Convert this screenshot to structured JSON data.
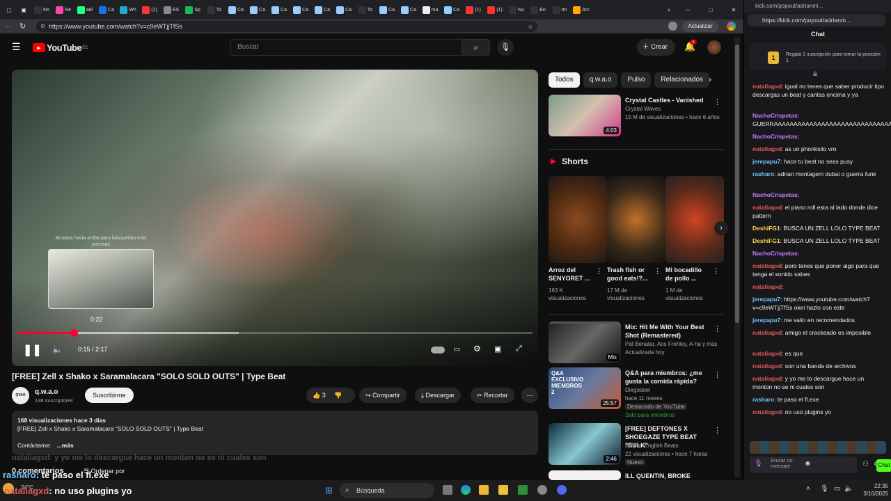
{
  "browser": {
    "url": "https://www.youtube.com/watch?v=c9eWTjjTfSs",
    "update_label": "Actualizar",
    "tabs": [
      "No",
      "Re",
      "adi",
      "Ca",
      "Wh",
      "(1)",
      "ES",
      "Sp",
      "To",
      "Ca",
      "Ca",
      "Ca",
      "Ca",
      "Ca",
      "Ca",
      "To",
      "Ca",
      "Ca",
      "ma",
      "Ca",
      "(1)",
      "(1)",
      "Nu",
      "En",
      "tm",
      "Arc"
    ],
    "window": {
      "min": "—",
      "max": "□",
      "close": "✕"
    }
  },
  "youtube": {
    "logo": "YouTube",
    "region": "EC",
    "search_placeholder": "Buscar",
    "create_label": "Crear",
    "notif_count": "1",
    "video": {
      "title": "[FREE] Zell x Shako x Saramalacara \"SOLO SOLD OUTS\" | Type Beat",
      "time": "0:15 / 2:17",
      "hover_time": "0:22",
      "hint": "Arrastra hacia arriba para búsquedas más precisas",
      "progress": 0.11,
      "buffered": 0.43,
      "hover": 0.163
    },
    "channel": {
      "name": "q.w.a.o",
      "subs": "138 suscriptores",
      "avatar": "QVAO"
    },
    "subscribe_label": "Suscribirme",
    "likes": "3",
    "actions": {
      "share": "Compartir",
      "download": "Descargar",
      "clip": "Recortar"
    },
    "description": {
      "stats": "168 visualizaciones  hace 3 días",
      "line1": "[FREE] Zell x Shako x Saramalacara \"SOLO SOLD OUTS\" | Type Beat",
      "line2": "Contáctame:",
      "more": "...más"
    },
    "comments_label": "0 comentarios",
    "sort_label": "Ordenar por",
    "chips": [
      "Todos",
      "q.w.a.o",
      "Pulso",
      "Relacionados"
    ],
    "related": [
      {
        "title": "Crystal Castles - Vanished",
        "channel": "Crystal Waves",
        "meta": "15 M de visualizaciones • hace 6 años",
        "dur": "4:03"
      },
      {
        "title": "Mix: Hit Me With Your Best Shot (Remastered)",
        "channel": "Pat Benatar, Ace Frehley, A-ha y más",
        "meta": "Actualizada hoy",
        "dur": "Mix"
      },
      {
        "title": "Q&A para miembros: ¿me gusta la comida rápida?",
        "channel": "Diegodoel",
        "meta": "hace 11 meses",
        "badge": "Destacado de YouTube",
        "badge2": "Solo para miembros",
        "dur": "25:57",
        "thumb_text": "Q&A EXCLUSIVO MIEMBROS 2"
      },
      {
        "title": "[FREE] DEFTONES X SHOEGAZE TYPE BEAT \"SULK\"",
        "channel": "Broken English Beats",
        "meta": "22 visualizaciones • hace 7 horas",
        "badge": "Nuevo",
        "dur": "2:46"
      },
      {
        "title": "ILL QUENTIN, BROKE CARREY -",
        "channel": "",
        "meta": "",
        "dur": ""
      }
    ],
    "shorts_title": "Shorts",
    "shorts": [
      {
        "title": "Arroz del SENYORET ...",
        "views": "163 K visualizaciones"
      },
      {
        "title": "Trash fish or good eats!?...",
        "views": "17 M de visualizaciones"
      },
      {
        "title": "Mi bocadillo de pollo ...",
        "views": "1 M de visualizaciones"
      }
    ]
  },
  "overlay": {
    "line1": "nataliagxd: y yo me lo descargue hace un monton no se ni cuales son",
    "line2_user": "rasharo",
    "line2_text": ": te paso el fl.exe",
    "line3_user": "nataliagxd",
    "line3_text": ": no uso plugins yo"
  },
  "kick": {
    "url": "https://kick.com/popout/adrianm...",
    "tab_url": "kick.com/popout/adrianmi...",
    "chat_title": "Chat",
    "pinned": "Regala 1 suscripción para tomar la posición 1",
    "pinned_rank": "1",
    "send_placeholder": "Enviar un mensaje",
    "chat_label": "Chat",
    "messages": [
      {
        "user": "nataliagxd",
        "color": "#e05a5a",
        "text": ": igual no tenes que saber producir tipo descargas un beat y cantas encima y ya"
      },
      {
        "user": "NachoCrispetas",
        "color": "#c77dff",
        "text": ": GUERRAAAAAAAAAAAAAAAAAAAAAAAAAAAAAAAAA"
      },
      {
        "user": "NachoCrispetas",
        "color": "#c77dff",
        "text": ":"
      },
      {
        "user": "nataliagxd",
        "color": "#e05a5a",
        "text": ": as un phonksito vro"
      },
      {
        "user": "jerepapu7",
        "color": "#6ec6ff",
        "text": ": hace tu beat no seas pusy"
      },
      {
        "user": "rasharo",
        "color": "#6ec6ff",
        "text": ": adrian montagem dubai o guerra funk"
      },
      {
        "user": "NachoCrispetas",
        "color": "#c77dff",
        "text": ":"
      },
      {
        "user": "nataliagxd",
        "color": "#e05a5a",
        "text": ": el piano roll esta al lado donde dice pattern"
      },
      {
        "user": "DeshiFG1",
        "color": "#ffd54f",
        "text": ": BUSCA UN ZELL LOLO TYPE BEAT"
      },
      {
        "user": "DeshiFG1",
        "color": "#ffd54f",
        "text": ": BUSCA UN ZELL LOLO TYPE BEAT"
      },
      {
        "user": "NachoCrispetas",
        "color": "#c77dff",
        "text": ":"
      },
      {
        "user": "nataliagxd",
        "color": "#e05a5a",
        "text": ": pero tenes que poner algo para que tenga el sonido sabes"
      },
      {
        "user": "nataliagxd",
        "color": "#e05a5a",
        "text": ":"
      },
      {
        "user": "jerepapu7",
        "color": "#6ec6ff",
        "text": ": https://www.youtube.com/watch?v=c9eWTjjTfSs okei hazlo con este"
      },
      {
        "user": "jerepapu7",
        "color": "#6ec6ff",
        "text": ": me salio en recomendados"
      },
      {
        "user": "nataliagxd",
        "color": "#e05a5a",
        "text": ": amigo el crackeado es imposible"
      },
      {
        "user": "nataliagxd",
        "color": "#e05a5a",
        "text": ": es que"
      },
      {
        "user": "nataliagxd",
        "color": "#e05a5a",
        "text": ": son una banda de archivos"
      },
      {
        "user": "nataliagxd",
        "color": "#e05a5a",
        "text": ": y yo me lo descargue hace un monton no se ni cuales son"
      },
      {
        "user": "rasharo",
        "color": "#6ec6ff",
        "text": ": te paso el fl.exe"
      },
      {
        "user": "nataliagxd",
        "color": "#e05a5a",
        "text": ": no uso plugins yo"
      }
    ]
  },
  "taskbar": {
    "search": "Búsqueda",
    "temp": "24°C",
    "time": "22:35",
    "date": "3/10/2025"
  }
}
